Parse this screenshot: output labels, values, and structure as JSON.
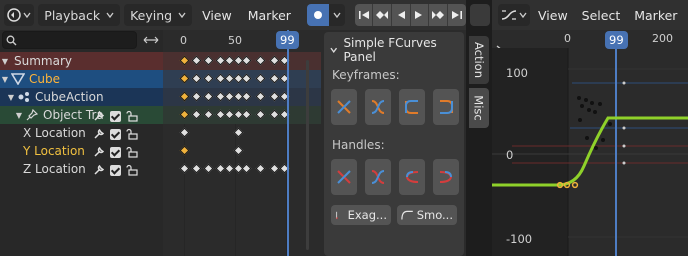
{
  "header": {
    "editor_icon": "dopesheet-icon",
    "playback_label": "Playback",
    "keying_label": "Keying",
    "view_label": "View",
    "marker_label": "Marker"
  },
  "search": {
    "placeholder": ""
  },
  "channels": [
    {
      "label": "Summary",
      "color": "#e0e0e0"
    },
    {
      "label": "Cube",
      "color": "#ffb53a"
    },
    {
      "label": "CubeAction",
      "color": "#e0e0e0"
    },
    {
      "label": "Object Tra",
      "color": "#e0e0e0"
    },
    {
      "label": "X Location",
      "color": "#e0e0e0"
    },
    {
      "label": "Y Location",
      "color": "#f0c040"
    },
    {
      "label": "Z Location",
      "color": "#e0e0e0"
    }
  ],
  "dopesheet": {
    "ticks": [
      "0",
      "50"
    ],
    "current_frame": "99"
  },
  "npanel": {
    "title": "Simple FCurves Panel",
    "keyframes_label": "Keyframes:",
    "handles_label": "Handles:",
    "exag_label": "Exag...",
    "smooth_label": "Smo..."
  },
  "tabs": {
    "action": "Action",
    "misc": "Misc"
  },
  "graph": {
    "view_label": "View",
    "select_label": "Select",
    "marker_label": "Marker",
    "ticks": [
      "0",
      "200"
    ],
    "current_frame": "99",
    "y_labels": [
      "100",
      "0",
      "-100"
    ]
  },
  "colors": {
    "accent": "#4772b3",
    "curve": "#8fd12a",
    "key_selected": "#f0b23c",
    "summary_bg": "#5a2e2e",
    "cube_bg": "#1e4e80",
    "action_bg": "#1b3557",
    "transform_bg": "#294a36"
  }
}
